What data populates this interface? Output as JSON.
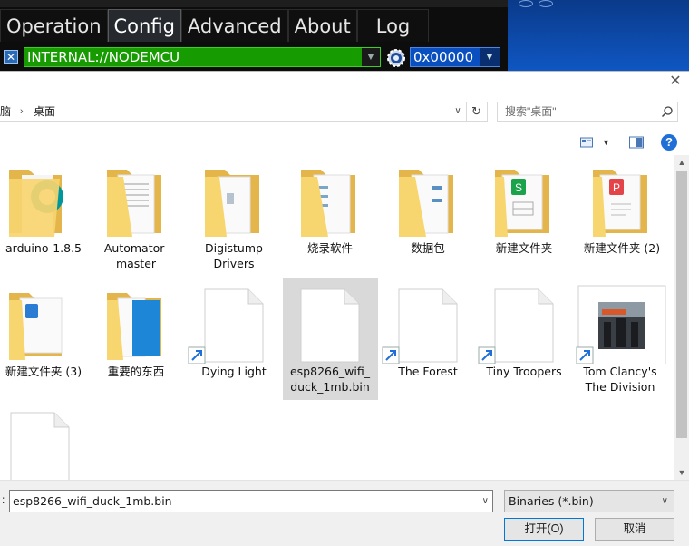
{
  "app": {
    "tabs": [
      "Operation",
      "Config",
      "Advanced",
      "About",
      "Log"
    ],
    "active_tab": "Config",
    "port_value": "INTERNAL://NODEMCU",
    "address_value": "0x00000",
    "colors": {
      "port_bg": "#169b00",
      "address_bg": "#0a4fbf",
      "background": "#0d0d0d"
    }
  },
  "dialog": {
    "breadcrumb": [
      "脑",
      "桌面"
    ],
    "search_placeholder": "搜索\"桌面\"",
    "items": [
      {
        "label": "arduino-1.8.5",
        "icon": "folder-arduino-icon"
      },
      {
        "label": "Automator-master",
        "icon": "folder-documents-icon"
      },
      {
        "label": "Digistump Drivers",
        "icon": "folder-documents-icon"
      },
      {
        "label": "烧录软件",
        "icon": "folder-documents-icon"
      },
      {
        "label": "数据包",
        "icon": "folder-documents-icon"
      },
      {
        "label": "新建文件夹",
        "icon": "folder-spreadsheet-icon"
      },
      {
        "label": "新建文件夹 (2)",
        "icon": "folder-pdf-icon"
      },
      {
        "label": "新建文件夹 (3)",
        "icon": "folder-word-icon"
      },
      {
        "label": "重要的东西",
        "icon": "folder-blue-icon"
      },
      {
        "label": "Dying Light",
        "icon": "shortcut-file-icon"
      },
      {
        "label": "esp8266_wifi_duck_1mb.bin",
        "icon": "file-icon",
        "selected": true
      },
      {
        "label": "The Forest",
        "icon": "shortcut-file-icon"
      },
      {
        "label": "Tiny Troopers",
        "icon": "shortcut-file-icon"
      },
      {
        "label": "Tom Clancy's The Division",
        "icon": "shortcut-image-icon"
      },
      {
        "label": "",
        "icon": "file-icon"
      }
    ],
    "filename_label": ":",
    "filename_value": "esp8266_wifi_duck_1mb.bin",
    "filter_value": "Binaries (*.bin)",
    "open_label": "打开(O)",
    "cancel_label": "取消"
  }
}
